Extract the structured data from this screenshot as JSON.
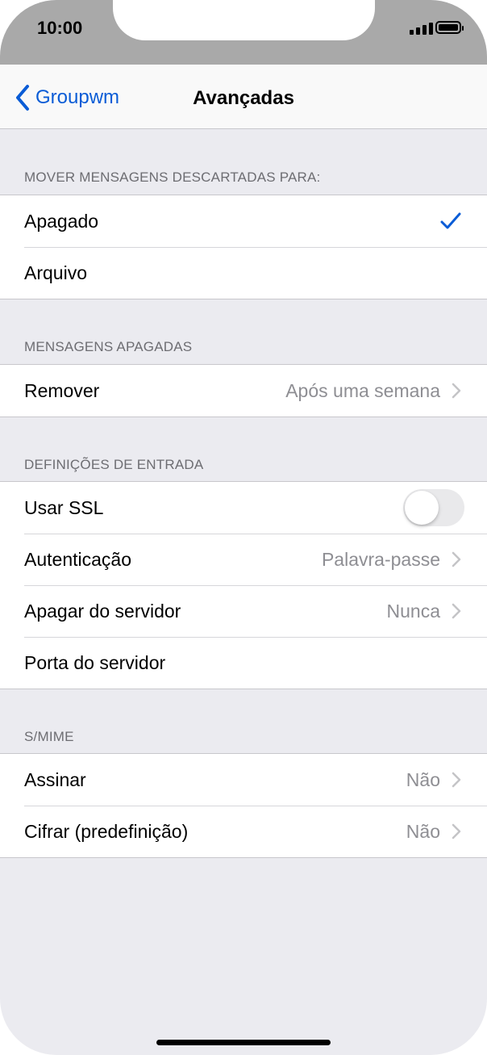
{
  "status": {
    "time": "10:00"
  },
  "nav": {
    "back_label": "Groupwm",
    "title": "Avançadas"
  },
  "sections": {
    "discard": {
      "header": "MOVER MENSAGENS DESCARTADAS PARA:",
      "rows": [
        {
          "label": "Apagado",
          "selected": true
        },
        {
          "label": "Arquivo",
          "selected": false
        }
      ]
    },
    "deleted": {
      "header": "MENSAGENS APAGADAS",
      "rows": [
        {
          "label": "Remover",
          "value": "Após uma semana"
        }
      ]
    },
    "incoming": {
      "header": "DEFINIÇÕES DE ENTRADA",
      "rows": [
        {
          "label": "Usar SSL",
          "toggle": false
        },
        {
          "label": "Autenticação",
          "value": "Palavra-passe"
        },
        {
          "label": "Apagar do servidor",
          "value": "Nunca"
        },
        {
          "label": "Porta do servidor"
        }
      ]
    },
    "smime": {
      "header": "S/MIME",
      "rows": [
        {
          "label": "Assinar",
          "value": "Não"
        },
        {
          "label": "Cifrar (predefinição)",
          "value": "Não"
        }
      ]
    }
  },
  "colors": {
    "accent": "#0a5cd6",
    "background": "#ebebf0",
    "secondary_text": "#8e8e93"
  }
}
